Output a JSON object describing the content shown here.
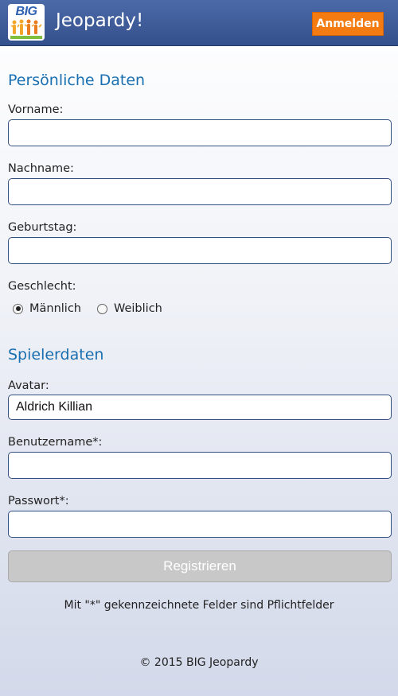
{
  "header": {
    "logo_text": "BIG",
    "title": "Jeopardy!",
    "login_label": "Anmelden",
    "colors": {
      "bar": "#3c5a99",
      "login": "#f47a12"
    }
  },
  "personal": {
    "heading": "Persönliche Daten",
    "firstname_label": "Vorname:",
    "firstname_value": "",
    "lastname_label": "Nachname:",
    "lastname_value": "",
    "birthday_label": "Geburtstag:",
    "birthday_value": "",
    "gender_label": "Geschlecht:",
    "gender_options": [
      {
        "label": "Männlich",
        "checked": true
      },
      {
        "label": "Weiblich",
        "checked": false
      }
    ]
  },
  "player": {
    "heading": "Spielerdaten",
    "avatar_label": "Avatar:",
    "avatar_value": "Aldrich Killian",
    "username_label": "Benutzername*:",
    "username_value": "",
    "password_label": "Passwort*:",
    "password_value": ""
  },
  "form": {
    "submit_label": "Registrieren",
    "submit_disabled": true,
    "required_note": "Mit \"*\" gekennzeichnete Felder sind Pflichtfelder"
  },
  "footer": {
    "copyright": "© 2015 BIG Jeopardy"
  }
}
